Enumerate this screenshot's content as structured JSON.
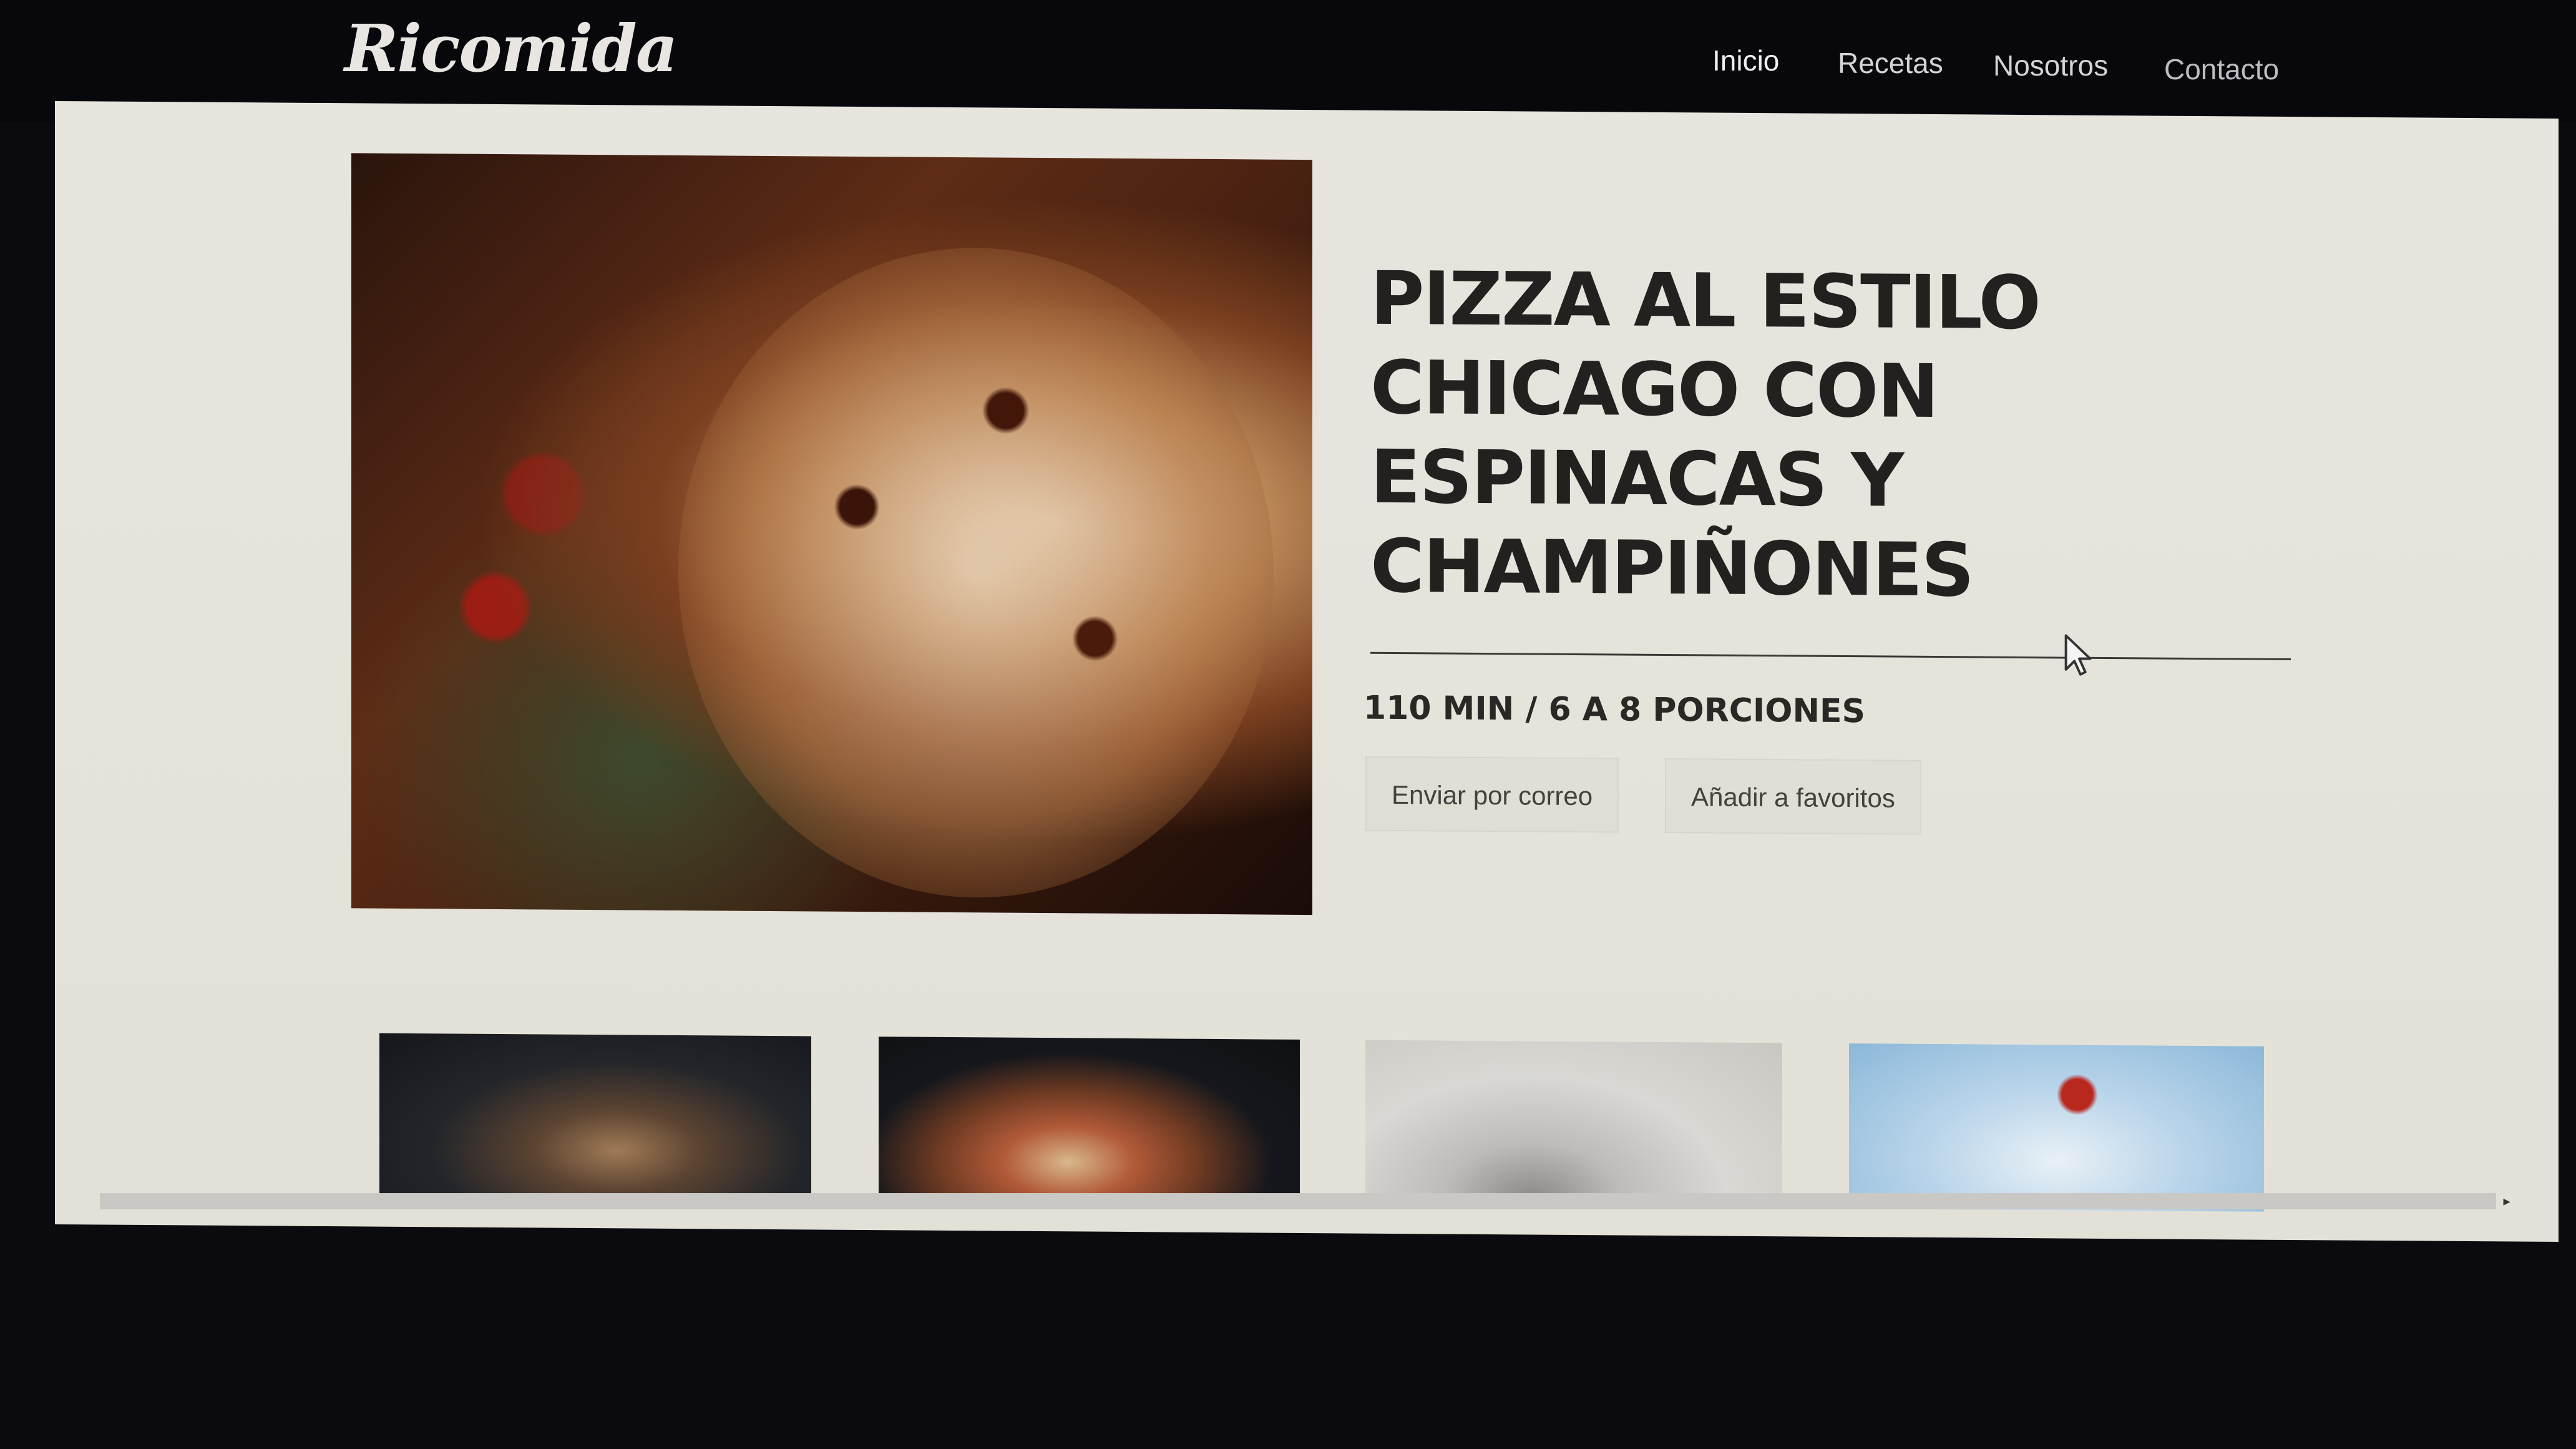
{
  "site": {
    "logo": "Ricomida"
  },
  "nav": {
    "items": [
      {
        "label": "Inicio"
      },
      {
        "label": "Recetas"
      },
      {
        "label": "Nosotros"
      },
      {
        "label": "Contacto"
      }
    ]
  },
  "recipe": {
    "title": "PIZZA AL ESTILO CHICAGO CON ESPINACAS Y CHAMPIÑONES",
    "meta": "110 MIN / 6 A 8 PORCIONES",
    "actions": {
      "email_label": "Enviar por correo",
      "favorite_label": "Añadir a favoritos"
    }
  },
  "colors": {
    "navbar_bg": "#08080c",
    "page_bg": "#e7e5de",
    "text_dark": "#23201f"
  },
  "icons": [
    "cursor-arrow-icon",
    "scroll-right-arrow-icon"
  ]
}
